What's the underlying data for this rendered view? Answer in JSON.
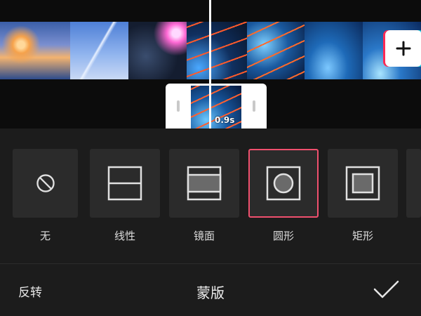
{
  "timeline": {
    "clip_duration": "0.9s",
    "add_clip_label": "+"
  },
  "masks": {
    "options": [
      {
        "label": "无",
        "icon": "none-icon"
      },
      {
        "label": "线性",
        "icon": "linear-mask-icon"
      },
      {
        "label": "镜面",
        "icon": "mirror-mask-icon"
      },
      {
        "label": "圆形",
        "icon": "circle-mask-icon",
        "selected": true
      },
      {
        "label": "矩形",
        "icon": "rectangle-mask-icon"
      }
    ],
    "selected_color": "#f0506e"
  },
  "bottom_bar": {
    "invert_label": "反转",
    "title": "蒙版",
    "confirm_icon": "checkmark-icon"
  }
}
